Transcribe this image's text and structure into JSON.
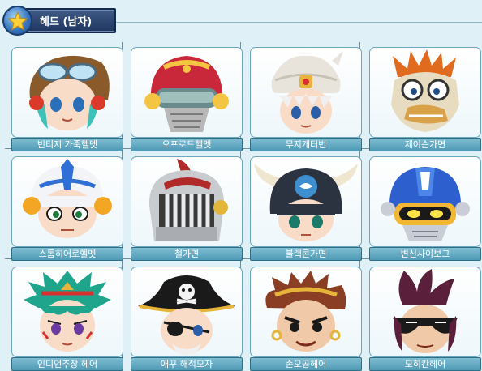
{
  "header": {
    "title": "헤드 (남자)",
    "icon": "star-icon"
  },
  "items": [
    {
      "name": "빈티지 가죽헬멧",
      "icon": "vintage-leather-helmet-icon",
      "accent": "#8a5a2b"
    },
    {
      "name": "오프로드헬멧",
      "icon": "offroad-helmet-icon",
      "accent": "#c8283a"
    },
    {
      "name": "무지개터번",
      "icon": "rainbow-turban-icon",
      "accent": "#e8e4dc"
    },
    {
      "name": "제이슨가면",
      "icon": "jason-mask-icon",
      "accent": "#d9a24a"
    },
    {
      "name": "스톰히어로헬멧",
      "icon": "storm-hero-helmet-icon",
      "accent": "#2f6fd6"
    },
    {
      "name": "철가면",
      "icon": "iron-mask-icon",
      "accent": "#b02a2a"
    },
    {
      "name": "블랙콘가면",
      "icon": "black-cone-mask-icon",
      "accent": "#2b3340"
    },
    {
      "name": "변신사이보그",
      "icon": "transform-cyborg-icon",
      "accent": "#2e5fcf"
    },
    {
      "name": "인디언추장 헤어",
      "icon": "indian-chief-hair-icon",
      "accent": "#1ea58c"
    },
    {
      "name": "애꾸 해적모자",
      "icon": "one-eyed-pirate-hat-icon",
      "accent": "#1a1a1a"
    },
    {
      "name": "손오공헤어",
      "icon": "sun-wukong-hair-icon",
      "accent": "#8a3f24"
    },
    {
      "name": "모히칸헤어",
      "icon": "mohican-hair-icon",
      "accent": "#5a1f3a"
    }
  ]
}
